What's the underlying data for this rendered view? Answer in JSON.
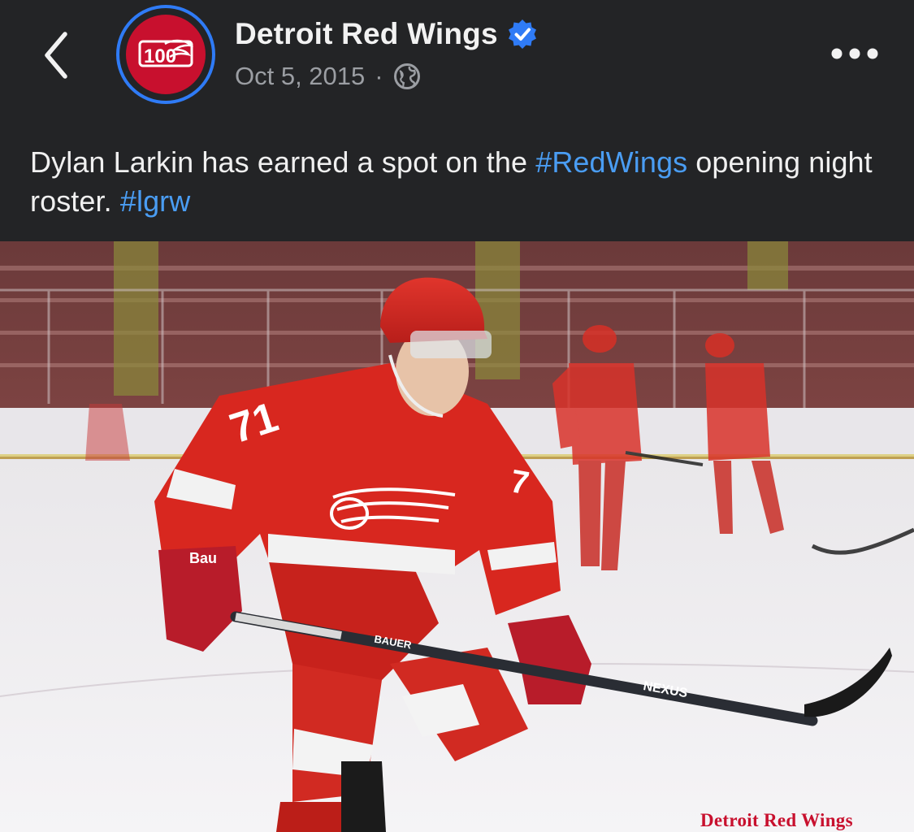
{
  "header": {
    "page_name": "Detroit Red Wings",
    "date": "Oct 5, 2015",
    "separator": "·",
    "avatar_logo_text": "100",
    "icons": {
      "back": "chevron-left-icon",
      "verified": "verified-badge-icon",
      "audience": "globe-icon",
      "more": "more-options-icon"
    }
  },
  "caption": {
    "text_before": "Dylan Larkin has earned a spot on the ",
    "hashtag_1": "#RedWings",
    "text_middle": " opening night roster. ",
    "hashtag_2": "#lgrw"
  },
  "photo": {
    "jersey_number": "71",
    "stick_brand_text": "NEXUS",
    "stick_shaft_text": "BAUER",
    "glove_text": "Bau",
    "watermark": "Detroit Red Wings"
  },
  "colors": {
    "background": "#232426",
    "text_primary": "#f2f2f2",
    "text_secondary": "#9b9ea3",
    "link": "#4a9df3",
    "verified": "#2f7bf6",
    "brand_red": "#c8102e"
  }
}
